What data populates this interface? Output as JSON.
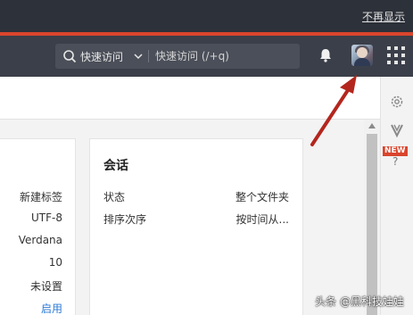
{
  "notice_bar": {
    "dismiss_link": "不再显示"
  },
  "topbar": {
    "search_scope": "快速访问",
    "search_placeholder": "快速访问 (/+q)"
  },
  "settings_card": {
    "values": [
      "新建标签",
      "UTF-8",
      "Verdana",
      "10",
      "未设置",
      "启用"
    ]
  },
  "session_card": {
    "title": "会话",
    "rows": [
      {
        "label": "状态",
        "value": "整个文件夹"
      },
      {
        "label": "排序次序",
        "value": "按时间从..."
      }
    ]
  },
  "right_rail": {
    "new_badge": "NEW",
    "help": "?"
  },
  "watermark": "头条 @黑科技娃娃",
  "colors": {
    "accent": "#d9452d",
    "topbar": "#3b3f49",
    "link": "#2b7ad6",
    "arrow": "#b3261e"
  }
}
